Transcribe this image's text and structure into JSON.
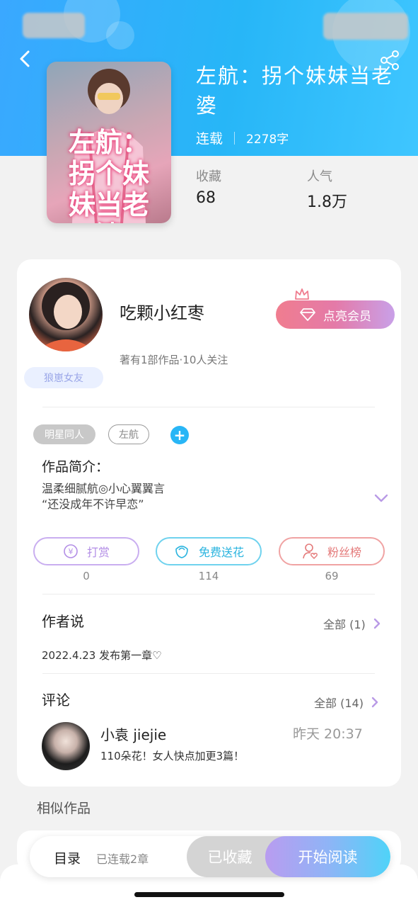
{
  "book": {
    "title": "左航：拐个妹妹当老婆",
    "status": "连载",
    "word_count": "2278字",
    "cover_text": "左航：拐个妹妹当老婆",
    "stats": [
      {
        "label": "收藏",
        "value": "68"
      },
      {
        "label": "人气",
        "value": "1.8万"
      }
    ]
  },
  "author": {
    "name": "吃颗小红枣",
    "meta": "著有1部作品·10人关注",
    "fan_tag": "狼崽女友",
    "member_button": "点亮会员"
  },
  "tags": [
    {
      "label": "明星同人",
      "style": "filled"
    },
    {
      "label": "左航",
      "style": "outline"
    }
  ],
  "intro": {
    "title": "作品简介：",
    "line1": "温柔细腻航◎小心翼翼言",
    "line2": "“还没成年不许早恋”"
  },
  "actions": [
    {
      "label": "打赏",
      "count": "0",
      "color": "#b99ae6",
      "icon": "yen-icon"
    },
    {
      "label": "免费送花",
      "count": "114",
      "color": "#41c2e8",
      "icon": "flower-icon"
    },
    {
      "label": "粉丝榜",
      "count": "69",
      "color": "#ee8a8a",
      "icon": "person-heart-icon"
    }
  ],
  "author_says": {
    "title": "作者说",
    "all": "全部 (1)",
    "text": "2022.4.23 发布第一章♡"
  },
  "comments": {
    "title": "评论",
    "all": "全部 (14)",
    "items": [
      {
        "name": "小袁 jiejie",
        "time": "昨天 20:37",
        "text": "110朵花！女人快点加更3篇！"
      }
    ]
  },
  "similar": {
    "title": "相似作品"
  },
  "bottom_bar": {
    "toc": "目录",
    "chapters": "已连载2章",
    "favorited": "已收藏",
    "read": "开始阅读"
  },
  "colors": {
    "header": "#2fb0fa",
    "accent_blue": "#29b6f6",
    "member_gradient": [
      "#f07d8f",
      "#c9a0e8"
    ]
  }
}
